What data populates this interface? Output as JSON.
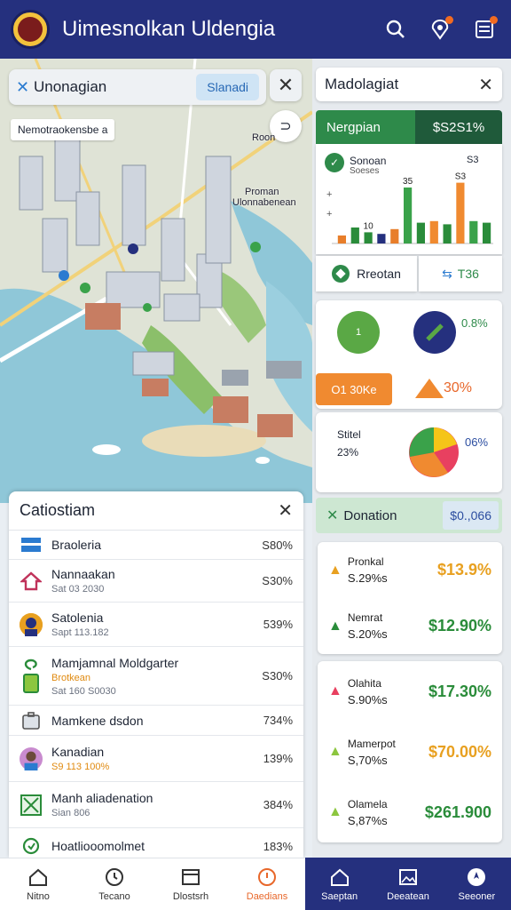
{
  "header": {
    "title": "Uimesnolkan Uldengia",
    "icons": [
      "search-icon",
      "location-pin-icon",
      "menu-list-icon"
    ],
    "accent": "#25307e",
    "badge_color": "#f26b21"
  },
  "map": {
    "search_text": "Unonagian",
    "search_chip": "Slanadi",
    "district_label": "Nemotraokensbe a",
    "labels": {
      "north": "Roon",
      "east_line1": "Proman",
      "east_line2": "Ulonnabenean"
    }
  },
  "list": {
    "title": "Catiostiam",
    "rows": [
      {
        "name": "Braoleria",
        "sub": "",
        "value": "S80%",
        "icon": "flag-icon"
      },
      {
        "name": "Nannaakan",
        "sub": "Sat 03 2030",
        "value": "S30%",
        "icon": "house-icon"
      },
      {
        "name": "Satolenia",
        "sub": "Sapt 113.182",
        "value": "539%",
        "icon": "avatar-icon"
      },
      {
        "name": "Mamjamnal Moldgarter",
        "sub": "Brotkean",
        "sub2": "Sat 160 S0030",
        "value": "S30%",
        "icon": "leaf-icon"
      },
      {
        "name": "Mamkene dsdon",
        "sub": "",
        "value": "734%",
        "icon": "briefcase-icon"
      },
      {
        "name": "Kanadian",
        "sub": "S9 113 100%",
        "value": "139%",
        "icon": "avatar-icon"
      },
      {
        "name": "Manh aliadenation",
        "sub": "Sian 806",
        "value": "384%",
        "icon": "map-icon"
      },
      {
        "name": "Hoatliooomolmet",
        "sub": "",
        "value": "183%",
        "icon": "leaf-icon"
      }
    ]
  },
  "panels": {
    "main_title": "Madolagiat",
    "green_bar": {
      "label": "Nergpian",
      "value": "$S2S1%"
    },
    "chart_card": {
      "title": "Sonoan",
      "subtitle": "Soeses",
      "corner_number": "S3"
    },
    "buttons": {
      "left": "Rreotan",
      "right": "T36"
    },
    "circles": {
      "pct": "0.8%",
      "orange_pill": "O1 30Ke",
      "triangle_value": "30%"
    },
    "pie_card": {
      "label": "Stitel",
      "value": "23%",
      "pct": "06%"
    },
    "donation": {
      "label": "Donation",
      "value": "$0.,066"
    },
    "stats": [
      {
        "label": "Pronkal",
        "sub": "S.29%s",
        "value": "$13.9%",
        "color": "#e8a020"
      },
      {
        "label": "Nemrat",
        "sub": "S.20%s",
        "value": "$12.90%",
        "color": "#2a8c3a"
      },
      {
        "label": "Olahita",
        "sub": "S.90%s",
        "value": "$17.30%",
        "color": "#2a8c3a"
      },
      {
        "label": "Mamerpot",
        "sub": "S,70%s",
        "value": "$70.00%",
        "color": "#e8a020"
      },
      {
        "label": "Olamela",
        "sub": "S,87%s",
        "value": "$261.900",
        "color": "#2a8c3a"
      }
    ]
  },
  "chart_data": {
    "type": "bar",
    "title": "",
    "data_labels": [
      "10",
      "35",
      "S3"
    ],
    "series": [
      {
        "values": [
          5,
          10,
          7,
          6,
          9,
          35,
          13,
          14,
          12,
          38,
          14,
          13
        ],
        "colors": [
          "#e87e2a",
          "#2a8c3a",
          "#2a8c3a",
          "#25307e",
          "#e87e2a",
          "#3aa24a",
          "#2a8c3a",
          "#f08a30",
          "#2a8c3a",
          "#f08a30",
          "#3aa24a",
          "#2a8c3a"
        ]
      }
    ],
    "ylim": [
      0,
      40
    ]
  },
  "nav": {
    "left": [
      {
        "label": "Nitno",
        "icon": "home-icon"
      },
      {
        "label": "Tecano",
        "icon": "clock-icon"
      },
      {
        "label": "Dlostsrh",
        "icon": "archive-icon"
      },
      {
        "label": "Daedians",
        "icon": "alert-icon"
      }
    ],
    "right": [
      {
        "label": "Saeptan",
        "icon": "home-icon"
      },
      {
        "label": "Deeatean",
        "icon": "image-icon"
      },
      {
        "label": "Seeoner",
        "icon": "compass-icon"
      }
    ]
  }
}
